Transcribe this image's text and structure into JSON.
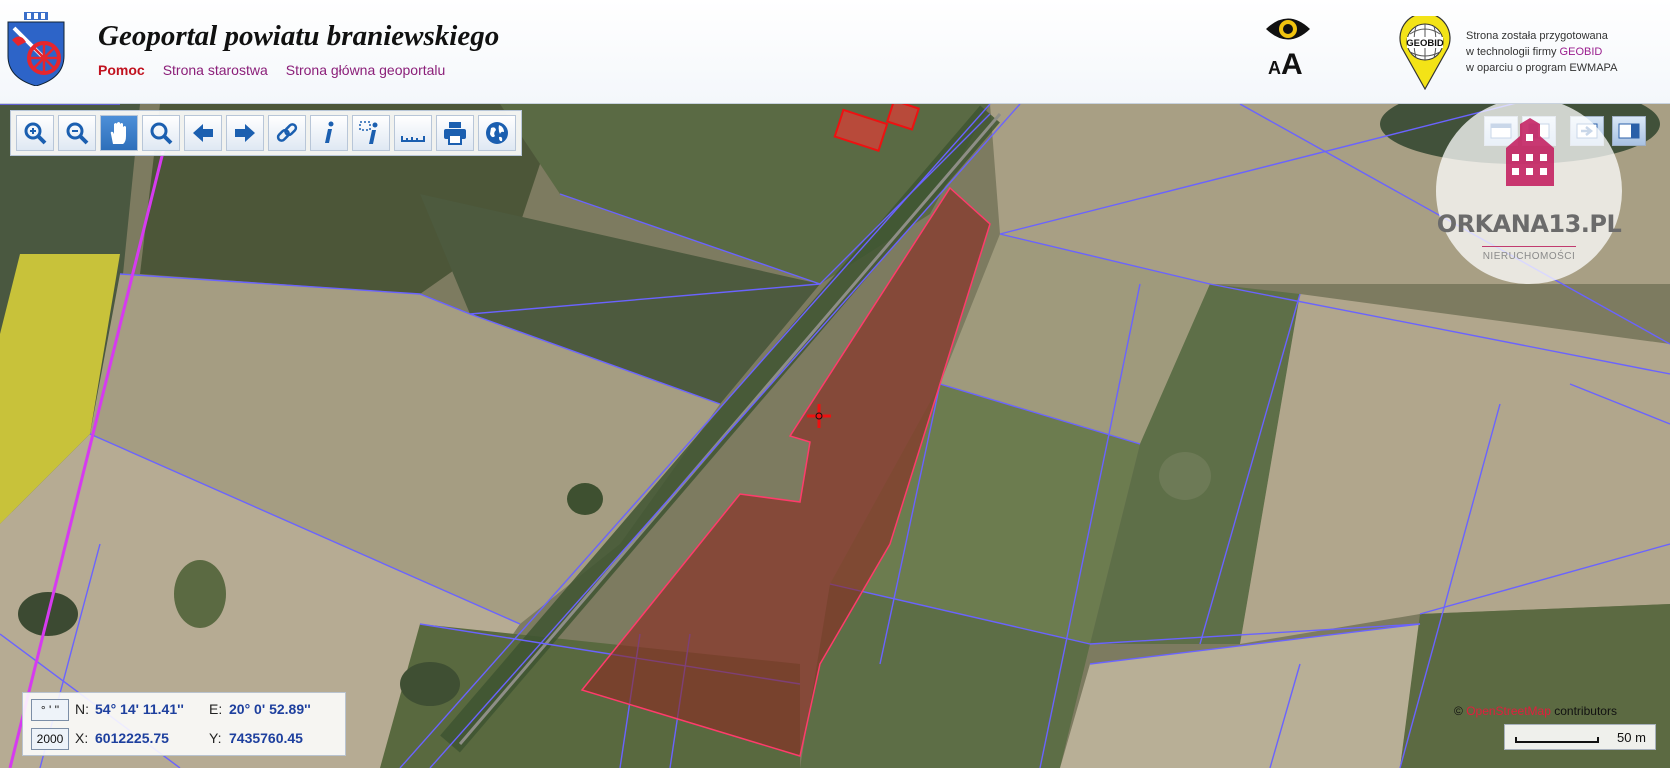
{
  "header": {
    "title": "Geoportal powiatu braniewskiego",
    "nav": {
      "help": "Pomoc",
      "starostwo": "Strona starostwa",
      "main": "Strona główna geoportalu"
    },
    "accessibility": {
      "small_a": "A",
      "big_a": "A"
    },
    "vendor": {
      "logo_text": "GEOBID",
      "line1": "Strona została przygotowana",
      "line2_prefix": "w technologii firmy",
      "line2_brand": "GEOBID",
      "line3": "w oparciu o program EWMAPA"
    }
  },
  "toolbar": {
    "buttons": [
      "zoom-in-icon",
      "zoom-out-icon",
      "pan-hand-icon",
      "zoom-extent-icon",
      "back-arrow-icon",
      "forward-arrow-icon",
      "link-icon",
      "info-icon",
      "info-select-icon",
      "measure-ruler-icon",
      "print-icon",
      "globe-icon"
    ],
    "active": "pan-hand-icon"
  },
  "watermark": {
    "brand": "ORKANA13.PL",
    "subtitle": "NIERUCHOMOŚCI"
  },
  "coords": {
    "format_button": "° ' ''",
    "system_button": "2000",
    "n_label": "N:",
    "n_value": "54° 14' 11.41''",
    "e_label": "E:",
    "e_value": "20° 0' 52.89''",
    "x_label": "X:",
    "x_value": "6012225.75",
    "y_label": "Y:",
    "y_value": "7435760.45"
  },
  "attribution": {
    "symbol": "©",
    "osm": "OpenStreetMap",
    "contributors": "contributors"
  },
  "scale": {
    "label": "50 m"
  },
  "colors": {
    "selection": "#8b2a22",
    "parcel_lines": "#6a63ff",
    "boundary": "#d63af0",
    "nav_link": "#8b1f79"
  }
}
